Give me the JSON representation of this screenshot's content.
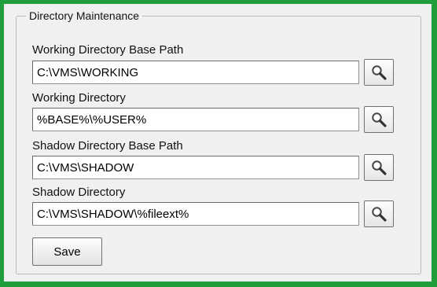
{
  "group": {
    "title": "Directory Maintenance"
  },
  "fields": [
    {
      "label": "Working Directory Base Path",
      "value": "C:\\VMS\\WORKING"
    },
    {
      "label": "Working Directory",
      "value": "%BASE%\\%USER%"
    },
    {
      "label": "Shadow Directory Base Path",
      "value": "C:\\VMS\\SHADOW"
    },
    {
      "label": "Shadow Directory",
      "value": "C:\\VMS\\SHADOW\\%fileext%"
    }
  ],
  "browse_icon": "magnifier-icon",
  "save_label": "Save",
  "colors": {
    "outer_border": "#1f9e3c",
    "panel_background": "#f0f0f0"
  }
}
